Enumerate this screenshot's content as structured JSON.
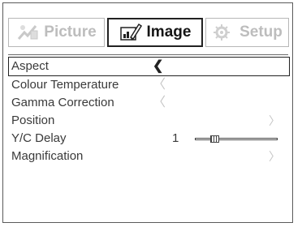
{
  "tabs": [
    {
      "label": "Picture",
      "icon": "picture-icon",
      "active": false
    },
    {
      "label": "Image",
      "icon": "image-edit-icon",
      "active": true
    },
    {
      "label": "Setup",
      "icon": "setup-icon",
      "active": false
    }
  ],
  "menu": {
    "items": [
      {
        "label": "Aspect",
        "selected": true,
        "left_arrow": "❮"
      },
      {
        "label": "Colour Temperature",
        "left_arrow": "〈"
      },
      {
        "label": "Gamma Correction",
        "left_arrow": "〈"
      },
      {
        "label": "Position",
        "right_arrow": "〉"
      },
      {
        "label": "Y/C Delay",
        "value": "1",
        "slider_fraction": 0.2
      },
      {
        "label": "Magnification",
        "right_arrow": "〉"
      }
    ]
  },
  "colors": {
    "active_text": "#151515",
    "inactive_text": "#bdbdbd",
    "border": "#222222"
  }
}
